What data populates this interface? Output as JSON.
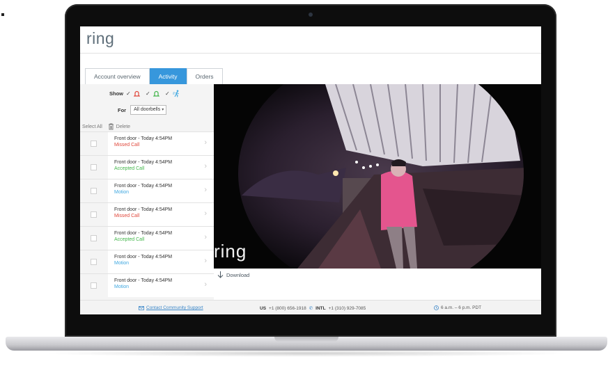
{
  "app": {
    "logo": "ring"
  },
  "tabs": [
    {
      "label": "Account overview",
      "active": false
    },
    {
      "label": "Activity",
      "active": true
    },
    {
      "label": "Orders",
      "active": false
    }
  ],
  "filters": {
    "show_label": "Show",
    "show_icons": [
      "bell-icon",
      "bell-icon",
      "motion-icon"
    ],
    "for_label": "For",
    "for_value": "All doorbells"
  },
  "actions": {
    "select_all": "Select All",
    "delete": "Delete"
  },
  "events": [
    {
      "title": "Front door - Today 4:54PM",
      "status": "Missed Call",
      "color": "#e0463a"
    },
    {
      "title": "Front door - Today 4:54PM",
      "status": "Accepted Call",
      "color": "#41b549"
    },
    {
      "title": "Front door - Today 4:54PM",
      "status": "Motion",
      "color": "#3ea7e0"
    },
    {
      "title": "Front door - Today 4:54PM",
      "status": "Missed Call",
      "color": "#e0463a"
    },
    {
      "title": "Front door - Today 4:54PM",
      "status": "Accepted Call",
      "color": "#41b549"
    },
    {
      "title": "Front door - Today 4:54PM",
      "status": "Motion",
      "color": "#3ea7e0"
    },
    {
      "title": "Front door - Today 4:54PM",
      "status": "Motion",
      "color": "#3ea7e0"
    }
  ],
  "video": {
    "watermark": "ring",
    "download_label": "Download"
  },
  "footer": {
    "support_link": "Contact Community Support",
    "us_label": "US",
    "us_phone": "+1 (800) 656-1918",
    "intl_label": "INTL",
    "intl_phone": "+1 (310) 929-7085",
    "hours": "6 a.m. – 6 p.m. PDT"
  },
  "colors": {
    "accent": "#3797dc",
    "missed": "#e0463a",
    "accepted": "#41b549",
    "motion": "#3ea7e0"
  }
}
